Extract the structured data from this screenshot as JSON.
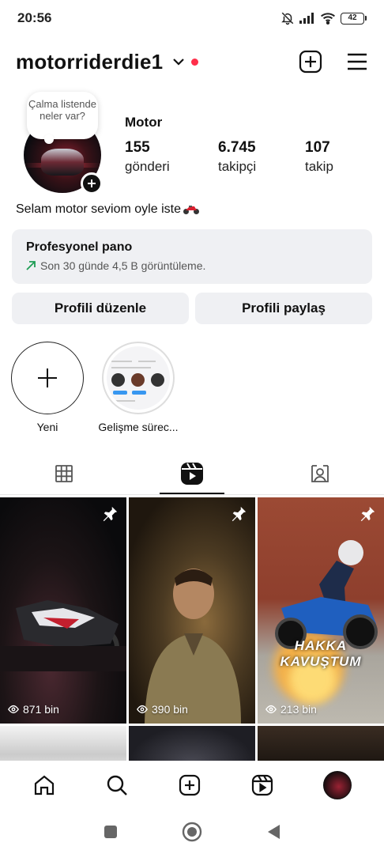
{
  "status_bar": {
    "time": "20:56",
    "battery": "42"
  },
  "header": {
    "username": "motorriderdie1"
  },
  "profile": {
    "note_bubble": "Çalma listende neler var?",
    "display_name": "Motor",
    "stats": [
      {
        "value": "155",
        "label": "gönderi"
      },
      {
        "value": "6.745",
        "label": "takipçi"
      },
      {
        "value": "107",
        "label": "takip"
      }
    ],
    "bio": "Selam motor seviom oyle iste"
  },
  "pro_panel": {
    "title": "Profesyonel pano",
    "subtitle": "Son 30 günde 4,5 B görüntüleme."
  },
  "buttons": {
    "edit": "Profili düzenle",
    "share": "Profili paylaş"
  },
  "highlights": [
    {
      "label": "Yeni"
    },
    {
      "label": "Gelişme sürec..."
    }
  ],
  "tabs": [
    "grid",
    "reels",
    "tagged"
  ],
  "reels": [
    {
      "views": "871 bin",
      "pinned": true
    },
    {
      "views": "390 bin",
      "pinned": true
    },
    {
      "views": "213 bin",
      "pinned": true,
      "overlay": "HAKKA KAVUŞTUM"
    }
  ],
  "bottom_nav": [
    "home",
    "search",
    "create",
    "reels",
    "profile"
  ],
  "colors": {
    "notification_dot": "#ff2e4a",
    "button_bg": "#eff0f3",
    "trend_arrow": "#1f9d55"
  }
}
